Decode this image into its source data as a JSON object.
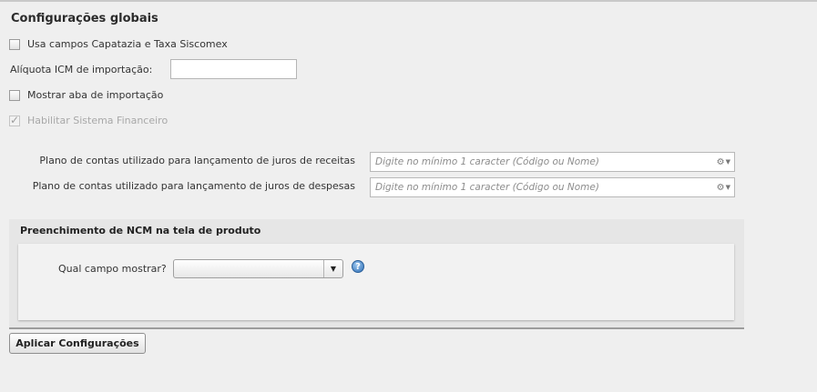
{
  "title": "Configurações globais",
  "options": {
    "capatazia_label": "Usa campos Capatazia e Taxa Siscomex",
    "capatazia_checked": false,
    "aliquota_label": "Alíquota ICM de importação:",
    "aliquota_value": "",
    "mostrar_aba_label": "Mostrar aba de importação",
    "mostrar_aba_checked": false,
    "financeiro_label": "Habilitar Sistema Financeiro",
    "financeiro_checked": true,
    "financeiro_disabled": true
  },
  "plano_contas": [
    {
      "label": "Plano de contas utilizado para lançamento de juros de receitas",
      "placeholder": "Digite no mínimo 1 caracter  (Código ou Nome)"
    },
    {
      "label": "Plano de contas utilizado para lançamento de juros de despesas",
      "placeholder": "Digite no mínimo 1 caracter  (Código ou Nome)"
    }
  ],
  "ncm_panel": {
    "title": "Preenchimento de NCM na tela de produto",
    "field_label": "Qual campo mostrar?",
    "selected_value": "",
    "help_symbol": "?"
  },
  "apply_button": "Aplicar Configurações",
  "icons": {
    "checkbox_tick": "✓",
    "gear": "⚙",
    "caret": "▼"
  }
}
